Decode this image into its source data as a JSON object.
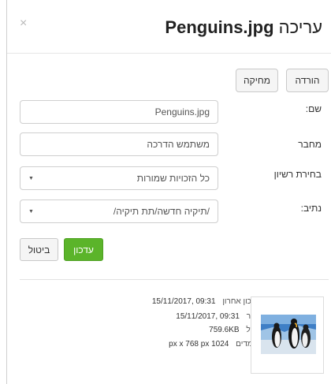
{
  "dialog": {
    "title_prefix": "עריכה",
    "title_file": "Penguins.jpg",
    "close_glyph": "×"
  },
  "actions": {
    "download_label": "הורדה",
    "delete_label": "מחיקה"
  },
  "form": {
    "name_label": "שם:",
    "name_value": "Penguins.jpg",
    "author_label": "מחבר",
    "author_value": "משתמש הדרכה",
    "license_label": "בחירת רשיון",
    "license_value": "כל הזכויות שמורות",
    "path_label": "נתיב:",
    "path_value": "/תיקיה חדשה/תת תיקיה/",
    "update_label": "עדכון",
    "cancel_label": "ביטול"
  },
  "file_info": {
    "modified_label": "עדכון אחרון",
    "modified_value": "09:31 ,15/11/2017",
    "created_label": "נוצר",
    "created_value": "09:31 ,15/11/2017",
    "size_label": "גודל",
    "size_value": "759.6KB",
    "dimensions_label": "מימדים",
    "dimensions_value": "1024 px x 768 px"
  }
}
